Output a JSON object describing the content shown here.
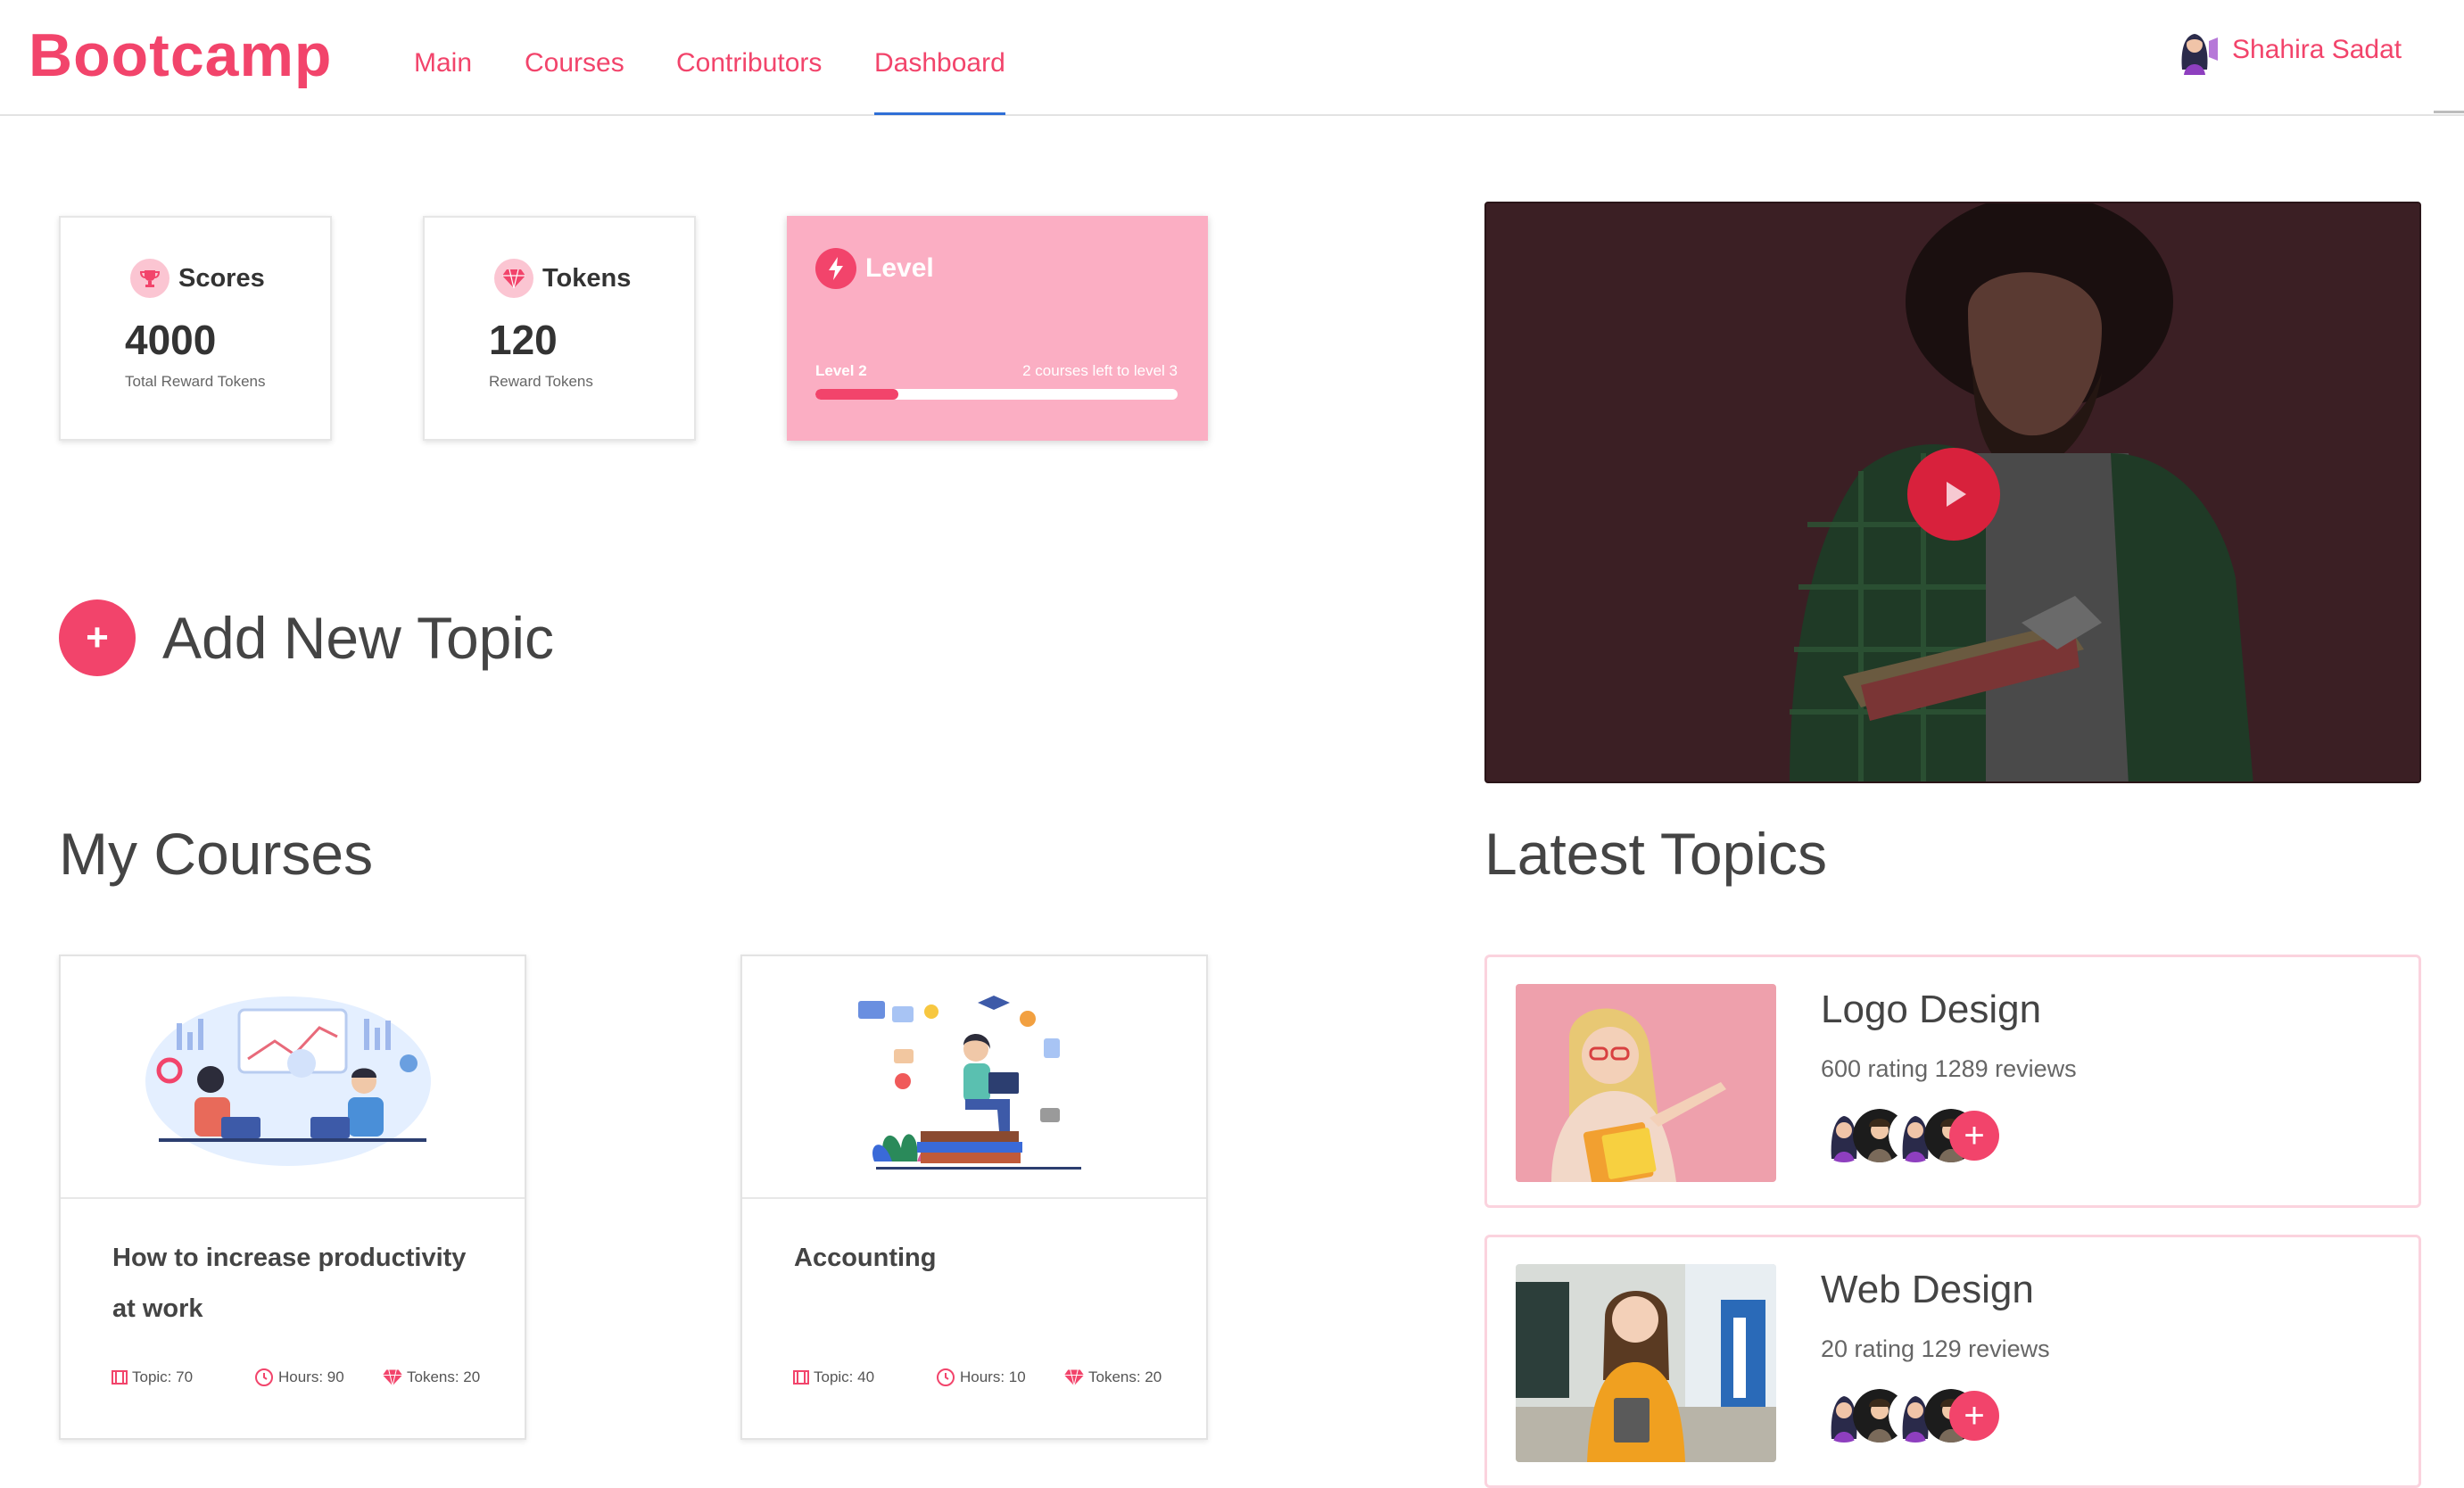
{
  "brand": "Bootcamp",
  "nav": {
    "items": [
      {
        "label": "Main"
      },
      {
        "label": "Courses"
      },
      {
        "label": "Contributors"
      },
      {
        "label": "Dashboard",
        "active": true
      }
    ]
  },
  "user": {
    "name": "Shahira Sadat",
    "icon": "user-avatar"
  },
  "stats": {
    "scores": {
      "title": "Scores",
      "value": "4000",
      "sub": "Total Reward Tokens",
      "icon": "trophy-icon"
    },
    "tokens": {
      "title": "Tokens",
      "value": "120",
      "sub": "Reward Tokens",
      "icon": "diamond-icon"
    }
  },
  "level": {
    "title": "Level",
    "icon": "lightning-icon",
    "current": "Level 2",
    "remaining": "2 courses left to level 3",
    "progress_fraction": 0.23
  },
  "add_topic": {
    "label": "Add New Topic",
    "icon": "plus-icon"
  },
  "video": {
    "icon": "play-icon"
  },
  "my_courses": {
    "title": "My Courses",
    "items": [
      {
        "title": "How to increase productivity at work",
        "topic": "Topic: 70",
        "hours": "Hours: 90",
        "tokens": "Tokens: 20"
      },
      {
        "title": "Accounting",
        "topic": "Topic: 40",
        "hours": "Hours: 10",
        "tokens": "Tokens: 20"
      }
    ]
  },
  "latest_topics": {
    "title": "Latest Topics",
    "items": [
      {
        "name": "Logo Design",
        "rating": "600 rating 1289 reviews"
      },
      {
        "name": "Web Design",
        "rating": "20 rating 129 reviews"
      }
    ]
  },
  "colors": {
    "accent": "#f2446b",
    "level_card": "#fbaec3",
    "active_underline": "#2f6fd6"
  }
}
